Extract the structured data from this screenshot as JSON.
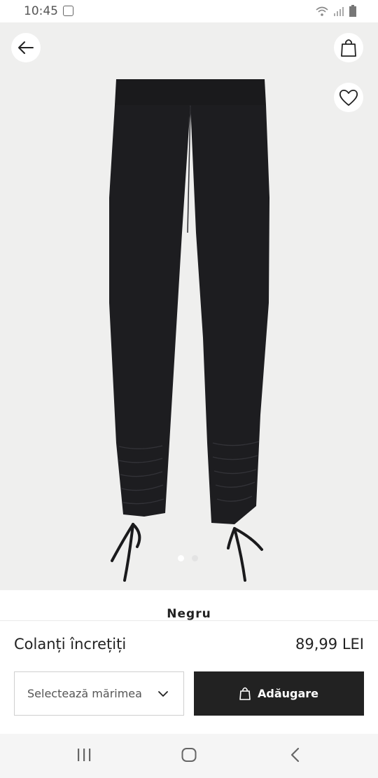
{
  "status_bar": {
    "time": "10:45",
    "icons": [
      "notification-icon",
      "wifi-icon",
      "signal-icon",
      "battery-icon"
    ]
  },
  "product": {
    "image_icon": "leggings-image",
    "carousel": {
      "count": 2,
      "active_index": 0
    },
    "color_name": "Negru",
    "title": "Colanți încrețiți",
    "price": "89,99 LEI"
  },
  "actions": {
    "back_icon": "arrow-left-icon",
    "bag_icon": "shopping-bag-icon",
    "favorite_icon": "heart-icon",
    "size_select_placeholder": "Selectează mărimea",
    "add_button_label": "Adăugare"
  },
  "navbar": {
    "items": [
      "recent-apps-icon",
      "home-icon",
      "back-nav-icon"
    ]
  },
  "colors": {
    "button_dark": "#222222",
    "image_bg": "#efefee"
  }
}
